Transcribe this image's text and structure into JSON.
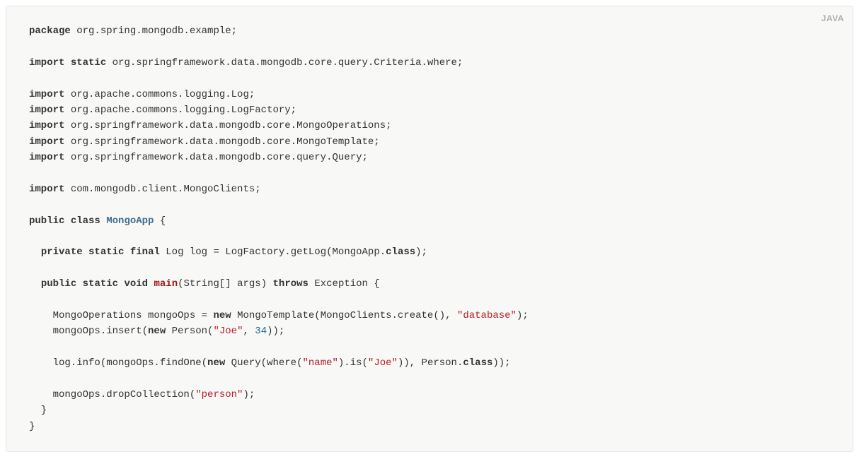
{
  "language_badge": "JAVA",
  "code": {
    "tokens": [
      {
        "t": "package",
        "c": "kw"
      },
      {
        "t": " org.spring.mongodb.example;",
        "c": "txt"
      },
      {
        "t": "\n\n",
        "c": "txt"
      },
      {
        "t": "import",
        "c": "kw"
      },
      {
        "t": " ",
        "c": "txt"
      },
      {
        "t": "static",
        "c": "kw"
      },
      {
        "t": " org.springframework.data.mongodb.core.query.Criteria.where;",
        "c": "txt"
      },
      {
        "t": "\n\n",
        "c": "txt"
      },
      {
        "t": "import",
        "c": "kw"
      },
      {
        "t": " org.apache.commons.logging.Log;",
        "c": "txt"
      },
      {
        "t": "\n",
        "c": "txt"
      },
      {
        "t": "import",
        "c": "kw"
      },
      {
        "t": " org.apache.commons.logging.LogFactory;",
        "c": "txt"
      },
      {
        "t": "\n",
        "c": "txt"
      },
      {
        "t": "import",
        "c": "kw"
      },
      {
        "t": " org.springframework.data.mongodb.core.MongoOperations;",
        "c": "txt"
      },
      {
        "t": "\n",
        "c": "txt"
      },
      {
        "t": "import",
        "c": "kw"
      },
      {
        "t": " org.springframework.data.mongodb.core.MongoTemplate;",
        "c": "txt"
      },
      {
        "t": "\n",
        "c": "txt"
      },
      {
        "t": "import",
        "c": "kw"
      },
      {
        "t": " org.springframework.data.mongodb.core.query.Query;",
        "c": "txt"
      },
      {
        "t": "\n\n",
        "c": "txt"
      },
      {
        "t": "import",
        "c": "kw"
      },
      {
        "t": " com.mongodb.client.MongoClients;",
        "c": "txt"
      },
      {
        "t": "\n\n",
        "c": "txt"
      },
      {
        "t": "public",
        "c": "kw"
      },
      {
        "t": " ",
        "c": "txt"
      },
      {
        "t": "class",
        "c": "kw"
      },
      {
        "t": " ",
        "c": "txt"
      },
      {
        "t": "MongoApp",
        "c": "cls"
      },
      {
        "t": " {",
        "c": "txt"
      },
      {
        "t": "\n\n",
        "c": "txt"
      },
      {
        "t": "  ",
        "c": "txt"
      },
      {
        "t": "private",
        "c": "kw"
      },
      {
        "t": " ",
        "c": "txt"
      },
      {
        "t": "static",
        "c": "kw"
      },
      {
        "t": " ",
        "c": "txt"
      },
      {
        "t": "final",
        "c": "kw"
      },
      {
        "t": " Log log = LogFactory.getLog(MongoApp.",
        "c": "txt"
      },
      {
        "t": "class",
        "c": "kw"
      },
      {
        "t": ");",
        "c": "txt"
      },
      {
        "t": "\n\n",
        "c": "txt"
      },
      {
        "t": "  ",
        "c": "txt"
      },
      {
        "t": "public",
        "c": "kw"
      },
      {
        "t": " ",
        "c": "txt"
      },
      {
        "t": "static",
        "c": "kw"
      },
      {
        "t": " ",
        "c": "txt"
      },
      {
        "t": "void",
        "c": "kw"
      },
      {
        "t": " ",
        "c": "txt"
      },
      {
        "t": "main",
        "c": "fn"
      },
      {
        "t": "(String[] args) ",
        "c": "txt"
      },
      {
        "t": "throws",
        "c": "kw"
      },
      {
        "t": " Exception {",
        "c": "txt"
      },
      {
        "t": "\n\n",
        "c": "txt"
      },
      {
        "t": "    MongoOperations mongoOps = ",
        "c": "txt"
      },
      {
        "t": "new",
        "c": "kw"
      },
      {
        "t": " MongoTemplate(MongoClients.create(), ",
        "c": "txt"
      },
      {
        "t": "\"database\"",
        "c": "str"
      },
      {
        "t": ");",
        "c": "txt"
      },
      {
        "t": "\n",
        "c": "txt"
      },
      {
        "t": "    mongoOps.insert(",
        "c": "txt"
      },
      {
        "t": "new",
        "c": "kw"
      },
      {
        "t": " Person(",
        "c": "txt"
      },
      {
        "t": "\"Joe\"",
        "c": "str"
      },
      {
        "t": ", ",
        "c": "txt"
      },
      {
        "t": "34",
        "c": "num"
      },
      {
        "t": "));",
        "c": "txt"
      },
      {
        "t": "\n\n",
        "c": "txt"
      },
      {
        "t": "    log.info(mongoOps.findOne(",
        "c": "txt"
      },
      {
        "t": "new",
        "c": "kw"
      },
      {
        "t": " Query(where(",
        "c": "txt"
      },
      {
        "t": "\"name\"",
        "c": "str"
      },
      {
        "t": ").is(",
        "c": "txt"
      },
      {
        "t": "\"Joe\"",
        "c": "str"
      },
      {
        "t": ")), Person.",
        "c": "txt"
      },
      {
        "t": "class",
        "c": "kw"
      },
      {
        "t": "));",
        "c": "txt"
      },
      {
        "t": "\n\n",
        "c": "txt"
      },
      {
        "t": "    mongoOps.dropCollection(",
        "c": "txt"
      },
      {
        "t": "\"person\"",
        "c": "str"
      },
      {
        "t": ");",
        "c": "txt"
      },
      {
        "t": "\n",
        "c": "txt"
      },
      {
        "t": "  }",
        "c": "txt"
      },
      {
        "t": "\n",
        "c": "txt"
      },
      {
        "t": "}",
        "c": "txt"
      }
    ]
  }
}
